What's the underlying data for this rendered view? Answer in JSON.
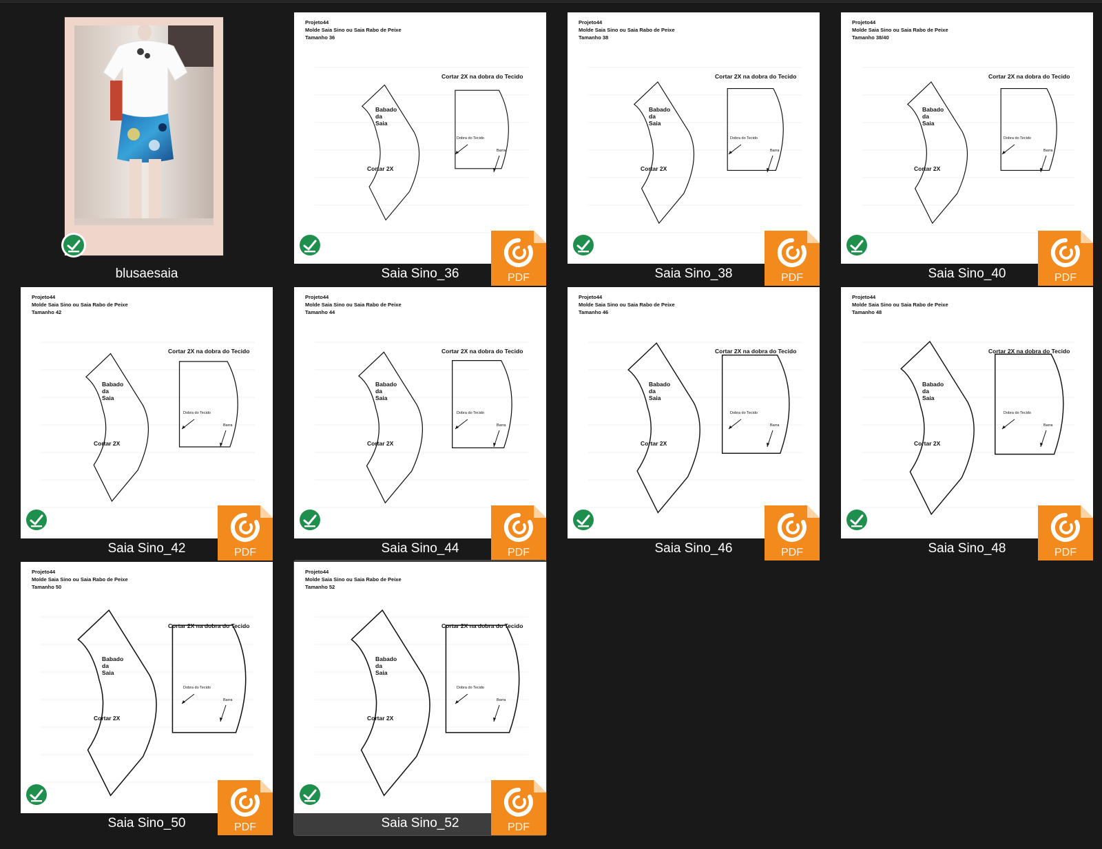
{
  "colors": {
    "background": "#191919",
    "selected_tile": "#3d3d3d",
    "check_green": "#1f8f4e",
    "pdf_orange": "#f28a1d"
  },
  "files": [
    {
      "name": "blusaesaia",
      "type": "image",
      "synced": true,
      "selected": false
    },
    {
      "name": "Saia Sino_36",
      "type": "pdf",
      "synced": true,
      "selected": false,
      "doc": {
        "line1": "Projeto44",
        "line2": "Molde Saia Sino ou Saia Rabo de Peixe",
        "line3": "Tamanho 36",
        "header": "Cortar 2X na dobra do Tecido",
        "piece_label_1": "Babado",
        "piece_label_2": "da",
        "piece_label_3": "Saia",
        "cut_label": "Cortar 2X",
        "fold_label": "Dobra do Tecido",
        "hem_label": "Barra"
      }
    },
    {
      "name": "Saia Sino_38",
      "type": "pdf",
      "synced": true,
      "selected": false,
      "doc": {
        "line1": "Projeto44",
        "line2": "Molde Saia Sino ou Saia Rabo de Peixe",
        "line3": "Tamanho 38",
        "header": "Cortar 2X na dobra do Tecido",
        "piece_label_1": "Babado",
        "piece_label_2": "da",
        "piece_label_3": "Saia",
        "cut_label": "Cortar 2X",
        "fold_label": "Dobra do Tecido",
        "hem_label": "Barra"
      }
    },
    {
      "name": "Saia Sino_40",
      "type": "pdf",
      "synced": true,
      "selected": false,
      "doc": {
        "line1": "Projeto44",
        "line2": "Molde Saia Sino ou Saia Rabo de Peixe",
        "line3": "Tamanho 38/40",
        "header": "Cortar 2X na dobra do Tecido",
        "piece_label_1": "Babado",
        "piece_label_2": "da",
        "piece_label_3": "Saia",
        "cut_label": "Cortar 2X",
        "fold_label": "Dobra do Tecido",
        "hem_label": "Barra"
      }
    },
    {
      "name": "Saia Sino_42",
      "type": "pdf",
      "synced": true,
      "selected": false,
      "doc": {
        "line1": "Projeto44",
        "line2": "Molde Saia Sino ou Saia Rabo de Peixe",
        "line3": "Tamanho 42",
        "header": "Cortar 2X na dobra do Tecido",
        "piece_label_1": "Babado",
        "piece_label_2": "da",
        "piece_label_3": "Saia",
        "cut_label": "Cortar 2X",
        "fold_label": "Dobra do Tecido",
        "hem_label": "Barra"
      }
    },
    {
      "name": "Saia Sino_44",
      "type": "pdf",
      "synced": true,
      "selected": false,
      "doc": {
        "line1": "Projeto44",
        "line2": "Molde Saia Sino ou Saia Rabo de Peixe",
        "line3": "Tamanho 44",
        "header": "Cortar 2X na dobra do Tecido",
        "piece_label_1": "Babado",
        "piece_label_2": "da",
        "piece_label_3": "Saia",
        "cut_label": "Cortar 2X",
        "fold_label": "Dobra do Tecido",
        "hem_label": "Barra"
      }
    },
    {
      "name": "Saia Sino_46",
      "type": "pdf",
      "synced": true,
      "selected": false,
      "doc": {
        "line1": "Projeto44",
        "line2": "Molde Saia Sino ou Saia Rabo de Peixe",
        "line3": "Tamanho 46",
        "header": "Cortar 2X na dobra do Tecido",
        "piece_label_1": "Babado",
        "piece_label_2": "da",
        "piece_label_3": "Saia",
        "cut_label": "Cortar 2X",
        "fold_label": "Dobra do Tecido",
        "hem_label": "Barra"
      }
    },
    {
      "name": "Saia Sino_48",
      "type": "pdf",
      "synced": true,
      "selected": false,
      "doc": {
        "line1": "Projeto44",
        "line2": "Molde Saia Sino ou Saia Rabo de Peixe",
        "line3": "Tamanho 48",
        "header": "Cortar 2X na dobra do Tecido",
        "piece_label_1": "Babado",
        "piece_label_2": "da",
        "piece_label_3": "Saia",
        "cut_label": "Cortar 2X",
        "fold_label": "Dobra do Tecido",
        "hem_label": "Barra"
      }
    },
    {
      "name": "Saia Sino_50",
      "type": "pdf",
      "synced": true,
      "selected": false,
      "doc": {
        "line1": "Projeto44",
        "line2": "Molde Saia Sino ou Saia Rabo de Peixe",
        "line3": "Tamanho 50",
        "header": "Cortar 2X na dobra do Tecido",
        "piece_label_1": "Babado",
        "piece_label_2": "da",
        "piece_label_3": "Saia",
        "cut_label": "Cortar 2X",
        "fold_label": "Dobra do Tecido",
        "hem_label": "Barra"
      }
    },
    {
      "name": "Saia Sino_52",
      "type": "pdf",
      "synced": true,
      "selected": true,
      "doc": {
        "line1": "Projeto44",
        "line2": "Molde Saia Sino ou Saia Rabo de Peixe",
        "line3": "Tamanho 52",
        "header": "Cortar 2X na dobra do Tecido",
        "piece_label_1": "Babado",
        "piece_label_2": "da",
        "piece_label_3": "Saia",
        "cut_label": "Cortar 2X",
        "fold_label": "Dobra do Tecido",
        "hem_label": "Barra"
      }
    }
  ],
  "icons": {
    "sync": "check-circle-icon",
    "file_type": "pdf-icon"
  },
  "pdf_badge_text": "PDF"
}
